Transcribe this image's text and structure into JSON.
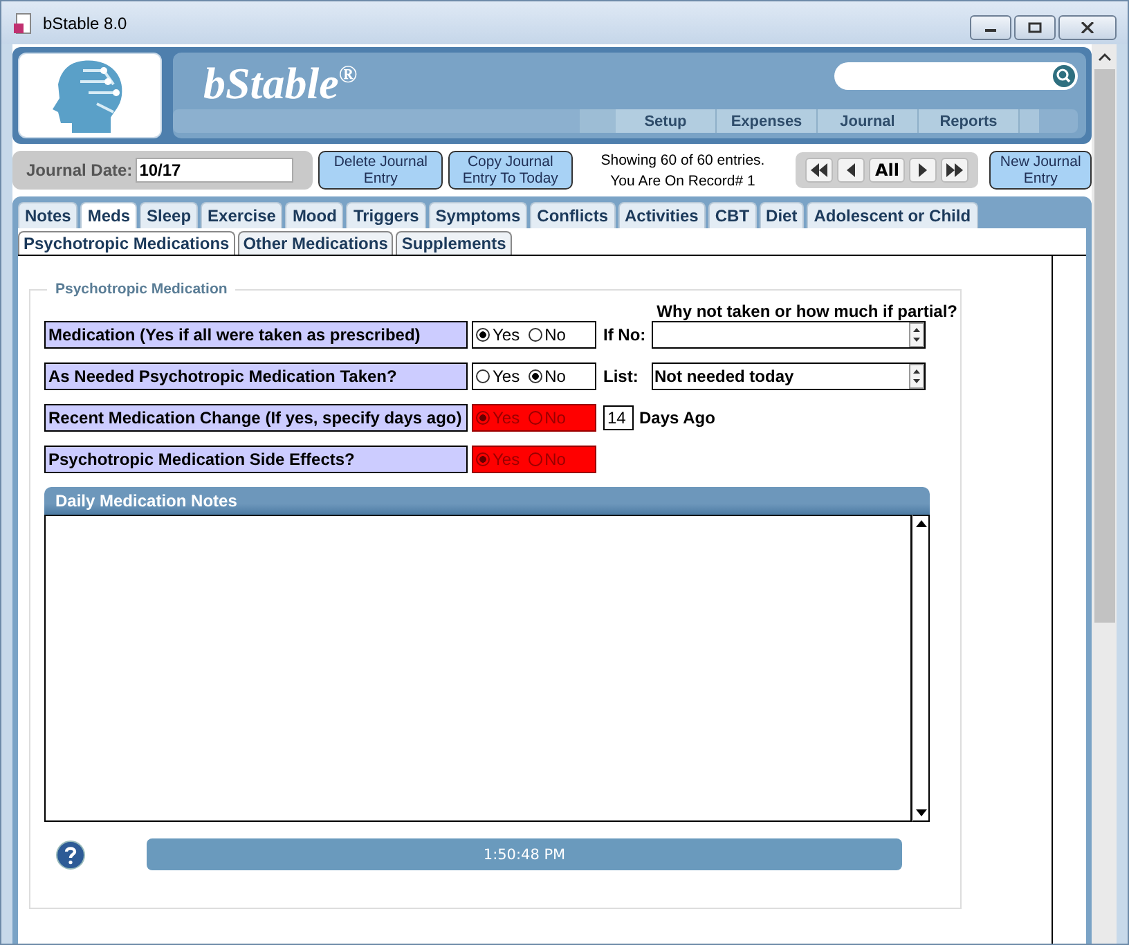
{
  "window": {
    "title": "bStable 8.0"
  },
  "header": {
    "logo": "bStable$^{®}$",
    "nav": [
      "Setup",
      "Expenses",
      "Journal",
      "Reports"
    ]
  },
  "toolbar": {
    "date_label": "Journal Date:",
    "date_value": "10/17",
    "delete_button": "Delete Journal Entry",
    "copy_button": "Copy Journal Entry To Today",
    "status_lines": [
      "Showing 60 of 60 entries.",
      "You Are On Record# 1"
    ],
    "pager_all": "All",
    "new_button": "New Journal Entry"
  },
  "tabs": [
    {
      "label": "Notes",
      "selected": false
    },
    {
      "label": "Meds",
      "selected": true
    },
    {
      "label": "Sleep",
      "selected": false
    },
    {
      "label": "Exercise",
      "selected": false
    },
    {
      "label": "Mood",
      "selected": false
    },
    {
      "label": "Triggers",
      "selected": false
    },
    {
      "label": "Symptoms",
      "selected": false
    },
    {
      "label": "Conflicts",
      "selected": false
    },
    {
      "label": "Activities",
      "selected": false
    },
    {
      "label": "CBT",
      "selected": false
    },
    {
      "label": "Diet",
      "selected": false
    },
    {
      "label": "Adolescent or Child",
      "selected": false
    }
  ],
  "subtabs": [
    {
      "label": "Psychotropic Medications",
      "selected": true
    },
    {
      "label": "Other Medications",
      "selected": false
    },
    {
      "label": "Supplements",
      "selected": false
    }
  ],
  "section": {
    "title": "Psychotropic Medication",
    "column_header": "Why not taken or how much if partial?"
  },
  "questions": [
    {
      "label": "Medication (Yes if all were taken as prescribed)",
      "alert": false,
      "options": [
        {
          "label": "Yes",
          "selected": true
        },
        {
          "label": "No",
          "selected": false
        }
      ],
      "kind": "spinner",
      "extra_label": "If No:"
    },
    {
      "label": "As Needed Psychotropic Medication Taken?",
      "alert": false,
      "options": [
        {
          "label": "Yes",
          "selected": false
        },
        {
          "label": "No",
          "selected": true
        }
      ],
      "kind": "spinner",
      "extra_label": "List:",
      "value": "Not needed today"
    },
    {
      "label": "Recent Medication Change (If yes, specify days ago)",
      "alert": true,
      "options": [
        {
          "label": "Yes",
          "selected": true
        },
        {
          "label": "No",
          "selected": false
        }
      ],
      "kind": "days",
      "value": "14",
      "extra_label": "Days Ago"
    },
    {
      "label": "Psychotropic Medication Side Effects?",
      "alert": true,
      "options": [
        {
          "label": "Yes",
          "selected": true
        },
        {
          "label": "No",
          "selected": false
        }
      ],
      "kind": "none"
    }
  ],
  "notes": {
    "title": "Daily Medication Notes"
  },
  "clock": "1:50:48 PM"
}
